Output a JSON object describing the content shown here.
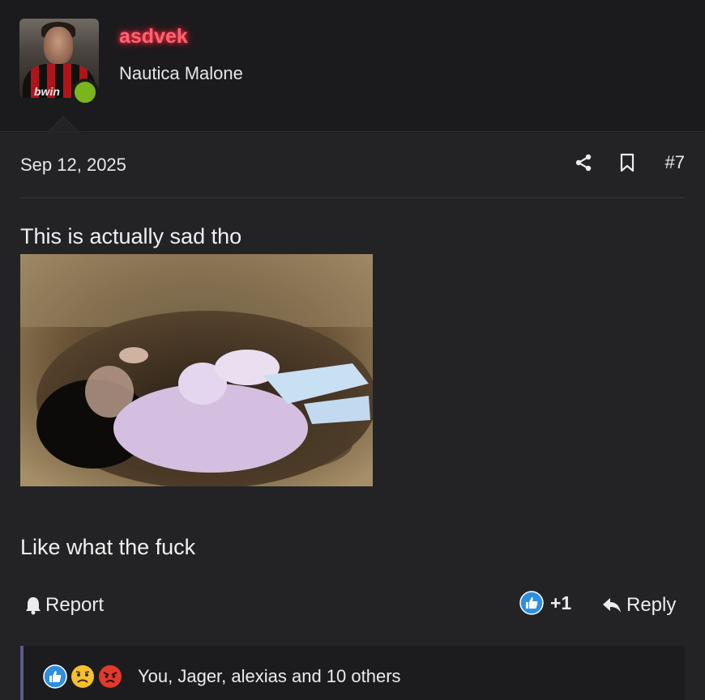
{
  "user": {
    "name": "asdvek",
    "title": "Nautica Malone",
    "avatar_sponsor": "bwin",
    "name_color": "#ff6470",
    "online_color": "#7ab51d"
  },
  "post": {
    "date": "Sep 12, 2025",
    "number": "#7",
    "text_before": "This is actually sad tho",
    "text_after": "Like what the fuck",
    "share_icon": "share-icon",
    "bookmark_icon": "bookmark-icon"
  },
  "footer": {
    "report_label": "Report",
    "reaction_count": "+1",
    "reply_label": "Reply"
  },
  "reactions": {
    "icons": [
      "like-icon",
      "sad-icon",
      "angry-icon"
    ],
    "summary": "You, Jager, alexias and 10 others"
  }
}
